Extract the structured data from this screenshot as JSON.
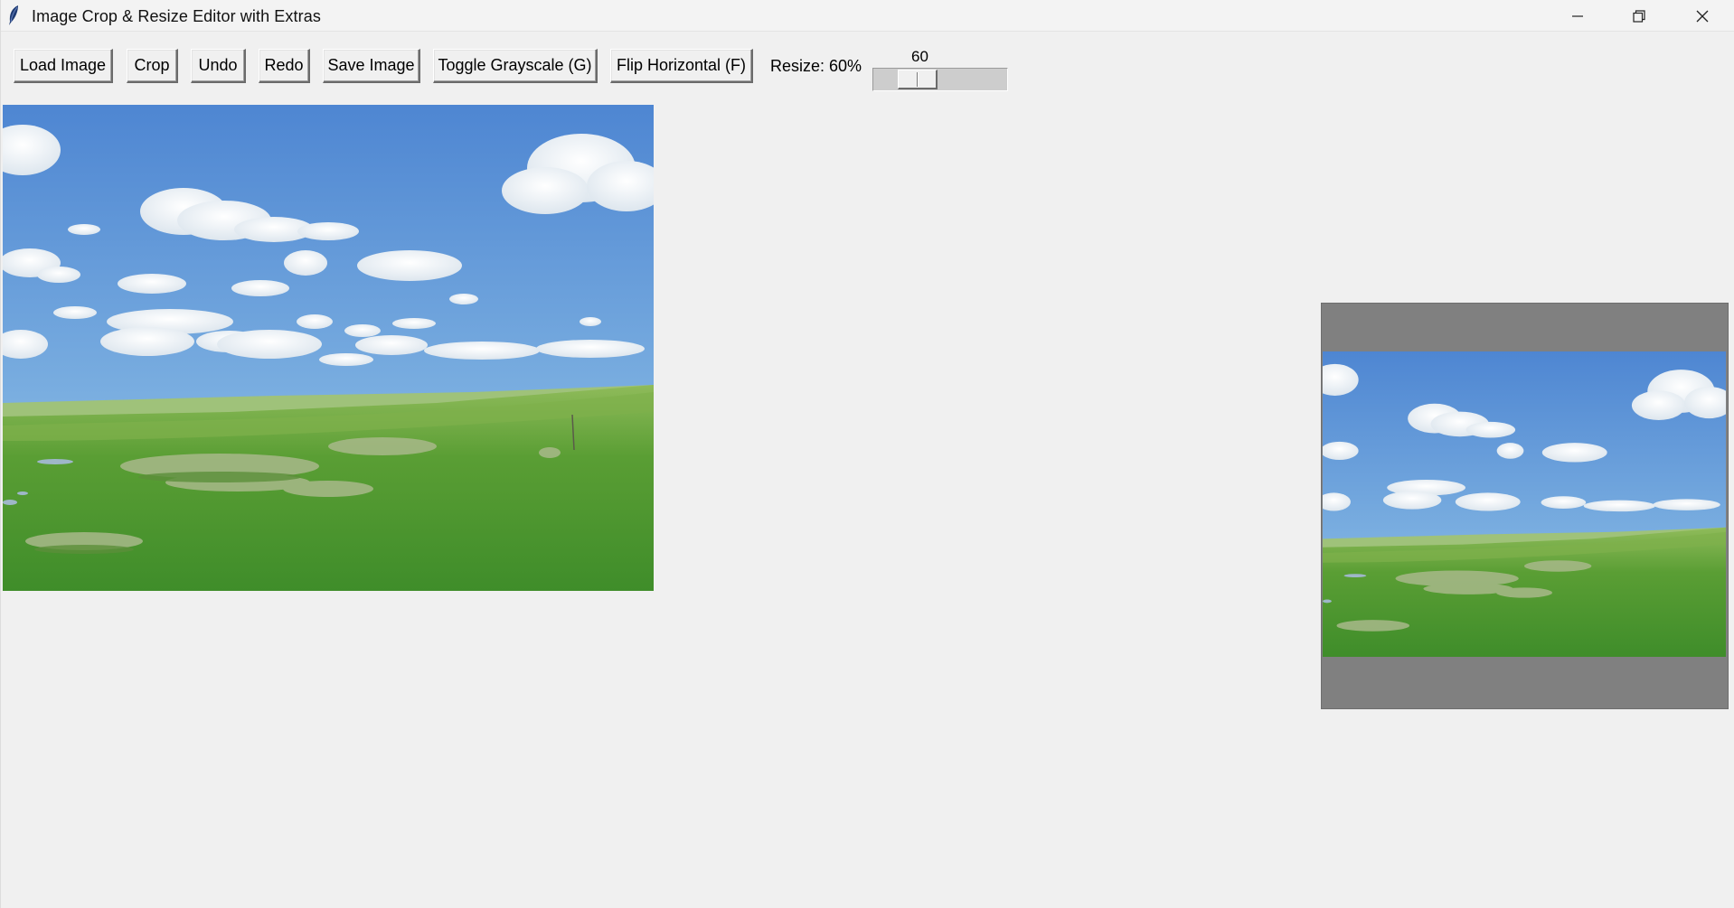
{
  "window": {
    "title": "Image Crop & Resize Editor with Extras",
    "icon": "feather-icon",
    "controls": {
      "minimize_icon": "minimize-icon",
      "maximize_icon": "restore-icon",
      "close_icon": "close-icon"
    }
  },
  "toolbar": {
    "load_label": "Load Image",
    "crop_label": "Crop",
    "undo_label": "Undo",
    "redo_label": "Redo",
    "save_label": "Save Image",
    "grayscale_label": "Toggle Grayscale (G)",
    "flip_label": "Flip Horizontal (F)",
    "resize_label": "Resize: 60%",
    "resize_value": "60",
    "resize_fraction": 0.6
  },
  "canvas": {
    "image_description_icon": "landscape-image",
    "preview_description_icon": "landscape-preview-image"
  },
  "colors": {
    "background": "#f0f0f0",
    "preview_bg": "#808080",
    "sky": "#5b8fd6",
    "grass": "#4f9a30"
  }
}
